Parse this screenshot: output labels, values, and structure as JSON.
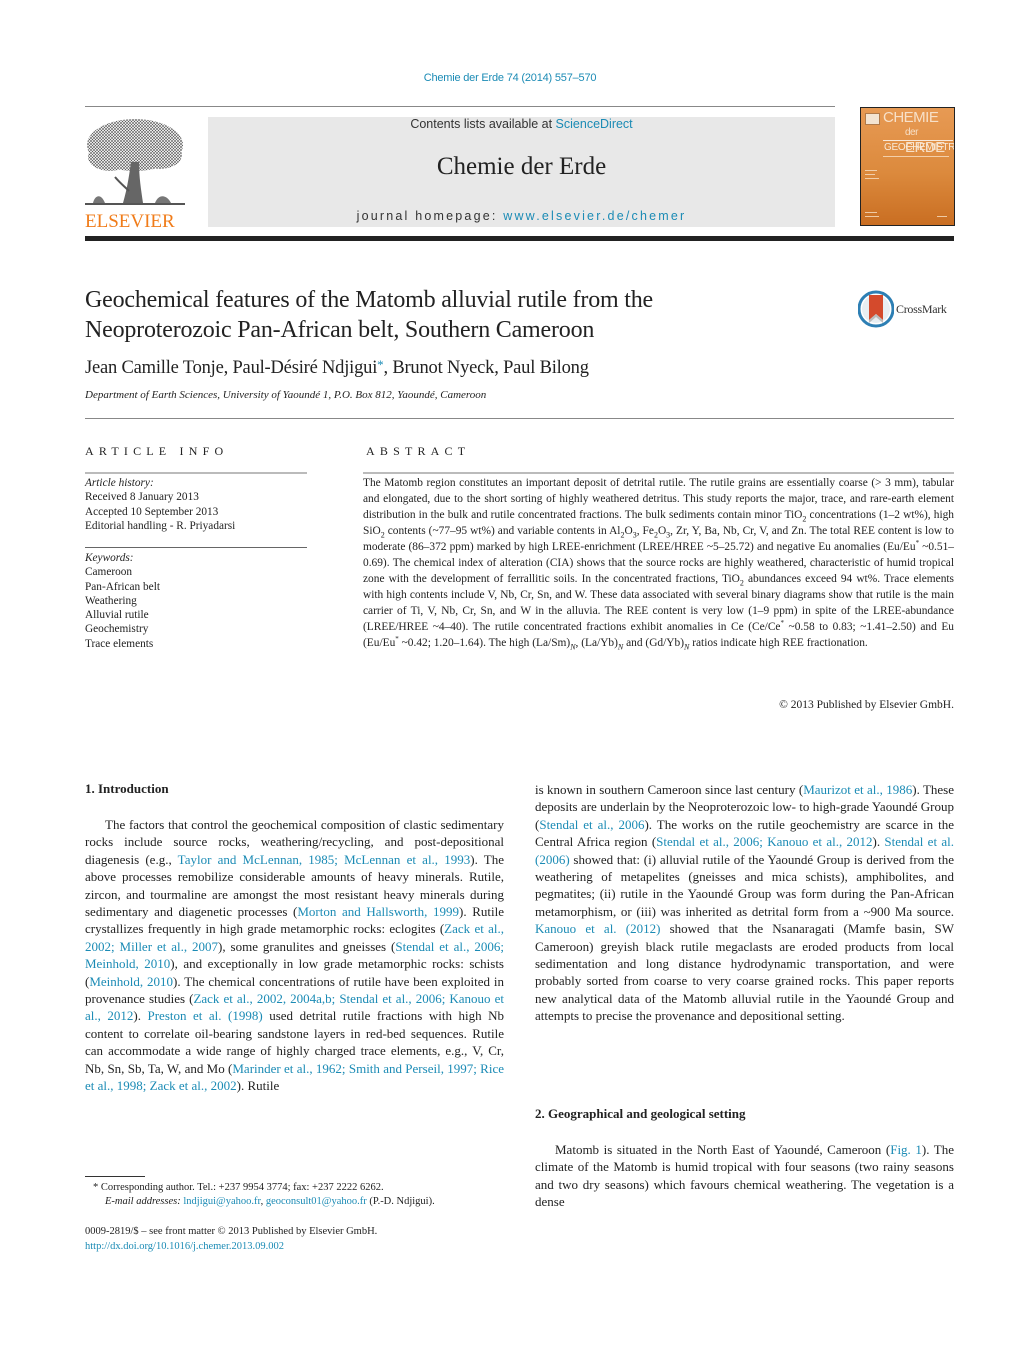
{
  "header": {
    "citation": "Chemie der Erde 74 (2014) 557–570",
    "publisher_logo_text": "ELSEVIER",
    "contents_prefix": "Contents lists available at ",
    "contents_link": "ScienceDirect",
    "journal_title": "Chemie der Erde",
    "homepage_prefix": "journal homepage: ",
    "homepage_link": "www.elsevier.de/chemer",
    "cover": {
      "line1": "CHEMIE",
      "line2_small": "der",
      "line2": " ERDE",
      "line3": "GEOCHEMISTRY"
    },
    "colors": {
      "link": "#1b8bb5",
      "elsevier_orange": "#f07c1a",
      "banner_bg": "#e8e8e8"
    }
  },
  "article": {
    "title_line1": "Geochemical features of the Matomb alluvial rutile from the",
    "title_line2": "Neoproterozoic Pan-African belt, Southern Cameroon",
    "crossmark_label": "CrossMark",
    "authors_part1": "Jean Camille Tonje, Paul-Désiré Ndjigui",
    "author_star": "*",
    "authors_part2": ", Brunot Nyeck, Paul Bilong",
    "affiliation": "Department of Earth Sciences, University of Yaoundé 1, P.O. Box 812, Yaoundé, Cameroon"
  },
  "article_info": {
    "heading": "ARTICLE INFO",
    "history_label": "Article history:",
    "history": [
      "Received 8 January 2013",
      "Accepted 10 September 2013",
      "Editorial handling - R. Priyadarsi"
    ],
    "keywords_label": "Keywords:",
    "keywords": [
      "Cameroon",
      "Pan-African belt",
      "Weathering",
      "Alluvial rutile",
      "Geochemistry",
      "Trace elements"
    ]
  },
  "abstract": {
    "heading": "ABSTRACT",
    "s1": "The Matomb region constitutes an important deposit of detrital rutile. The rutile grains are essentially coarse (> 3 mm), tabular and elongated, due to the short sorting of highly weathered detritus. This study reports the major, trace, and rare-earth element distribution in the bulk and rutile concentrated fractions. The bulk sediments contain minor TiO",
    "s2": " concentrations (1–2 wt%), high SiO",
    "s3": " contents (~77–95 wt%) and variable contents in Al",
    "s4": "O",
    "s5": ", Fe",
    "s6": "O",
    "s7": ", Zr, Y, Ba, Nb, Cr, V, and Zn. The total REE content is low to moderate (86–372 ppm) marked by high LREE-enrichment (LREE/HREE ~5–25.72) and negative Eu anomalies (Eu/Eu",
    "s8": " ~0.51–0.69). The chemical index of alteration (CIA) shows that the source rocks are highly weathered, characteristic of humid tropical zone with the development of ferrallitic soils. In the concentrated fractions, TiO",
    "s9": " abundances exceed 94 wt%. Trace elements with high contents include V, Nb, Cr, Sn, and W. These data associated with several binary diagrams show that rutile is the main carrier of Ti, V, Nb, Cr, Sn, and W in the alluvia. The REE content is very low (1–9 ppm) in spite of the LREE-abundance (LREE/HREE ~4–40). The rutile concentrated fractions exhibit anomalies in Ce (Ce/Ce",
    "s10": " ~0.58 to 0.83; ~1.41–2.50) and Eu (Eu/Eu",
    "s11": " ~0.42; 1.20–1.64). The high (La/Sm)",
    "s12": ", (La/Yb)",
    "s13": " and (Gd/Yb)",
    "s14": " ratios indicate high REE fractionation.",
    "sub2": "2",
    "sub3": "3",
    "subN": "N",
    "star": "*",
    "copyright": "© 2013 Published by Elsevier GmbH."
  },
  "body": {
    "sec1_title": "1.  Introduction",
    "p1": [
      {
        "t": "The factors that control the geochemical composition of clastic sedimentary rocks include source rocks, weathering/recycling, and post-depositional diagenesis (e.g., "
      },
      {
        "l": "Taylor and McLennan, 1985; McLennan et al., 1993"
      },
      {
        "t": "). The above processes remobilize considerable amounts of heavy minerals. Rutile, zircon, and tourmaline are amongst the most resistant heavy minerals during sedimentary and diagenetic processes ("
      },
      {
        "l": "Morton and Hallsworth, 1999"
      },
      {
        "t": "). Rutile crystallizes frequently in high grade metamorphic rocks: eclogites ("
      },
      {
        "l": "Zack et al., 2002; Miller et al., 2007"
      },
      {
        "t": "), some granulites and gneisses ("
      },
      {
        "l": "Stendal et al., 2006; Meinhold, 2010"
      },
      {
        "t": "), and exceptionally in low grade metamorphic rocks: schists ("
      },
      {
        "l": "Meinhold, 2010"
      },
      {
        "t": "). The chemical concentrations of rutile have been exploited in provenance studies ("
      },
      {
        "l": "Zack et al., 2002, 2004a,b; Stendal et al., 2006; Kanouo et al., 2012"
      },
      {
        "t": "). "
      },
      {
        "l": "Preston et al. (1998)"
      },
      {
        "t": " used detrital rutile fractions with high Nb content to correlate oil-bearing sandstone layers in red-bed sequences. Rutile can accommodate a wide range of highly charged trace elements, e.g., V, Cr, Nb, Sn, Sb, Ta, W, and Mo ("
      },
      {
        "l": "Marinder et al., 1962; Smith and Perseil, 1997; Rice et al., 1998; Zack et al., 2002"
      },
      {
        "t": "). Rutile"
      }
    ],
    "p2": [
      {
        "t": "is known in southern Cameroon since last century ("
      },
      {
        "l": "Maurizot et al., 1986"
      },
      {
        "t": "). These deposits are underlain by the Neoproterozoic low- to high-grade Yaoundé Group ("
      },
      {
        "l": "Stendal et al., 2006"
      },
      {
        "t": "). The works on the rutile geochemistry are scarce in the Central Africa region ("
      },
      {
        "l": "Stendal et al., 2006; Kanouo et al., 2012"
      },
      {
        "t": "). "
      },
      {
        "l": "Stendal et al. (2006)"
      },
      {
        "t": " showed that: (i) alluvial rutile of the Yaoundé Group is derived from the weathering of metapelites (gneisses and mica schists), amphibolites, and pegmatites; (ii) rutile in the Yaoundé Group was form during the Pan-African metamorphism, or (iii) was inherited as detrital form from a ~900 Ma source. "
      },
      {
        "l": "Kanouo et al. (2012)"
      },
      {
        "t": " showed that the Nsanaragati (Mamfe basin, SW Cameroon) greyish black rutile megaclasts are eroded products from local sedimentation and long distance hydrodynamic transportation, and were probably sorted from coarse to very coarse grained rocks. This paper reports new analytical data of the Matomb alluvial rutile in the Yaoundé Group and attempts to precise the provenance and depositional setting."
      }
    ],
    "sec2_title": "2.  Geographical and geological setting",
    "p3": [
      {
        "t": "Matomb is situated in the North East of Yaoundé, Cameroon ("
      },
      {
        "l": "Fig. 1"
      },
      {
        "t": "). The climate of the Matomb is humid tropical with four seasons (two rainy seasons and two dry seasons) which favours chemical weathering. The vegetation is a dense"
      }
    ]
  },
  "footnote": {
    "line1": "* Corresponding author. Tel.: +237 9954 3774; fax: +237 2222 6262.",
    "email_label": "E-mail addresses: ",
    "email1": "lndjigui@yahoo.fr",
    "sep": ", ",
    "email2": "geoconsult01@yahoo.fr",
    "email_suffix": " (P.-D. Ndjigui).",
    "issn": "0009-2819/$ – see front matter © 2013 Published by Elsevier GmbH.",
    "doi": "http://dx.doi.org/10.1016/j.chemer.2013.09.002"
  }
}
